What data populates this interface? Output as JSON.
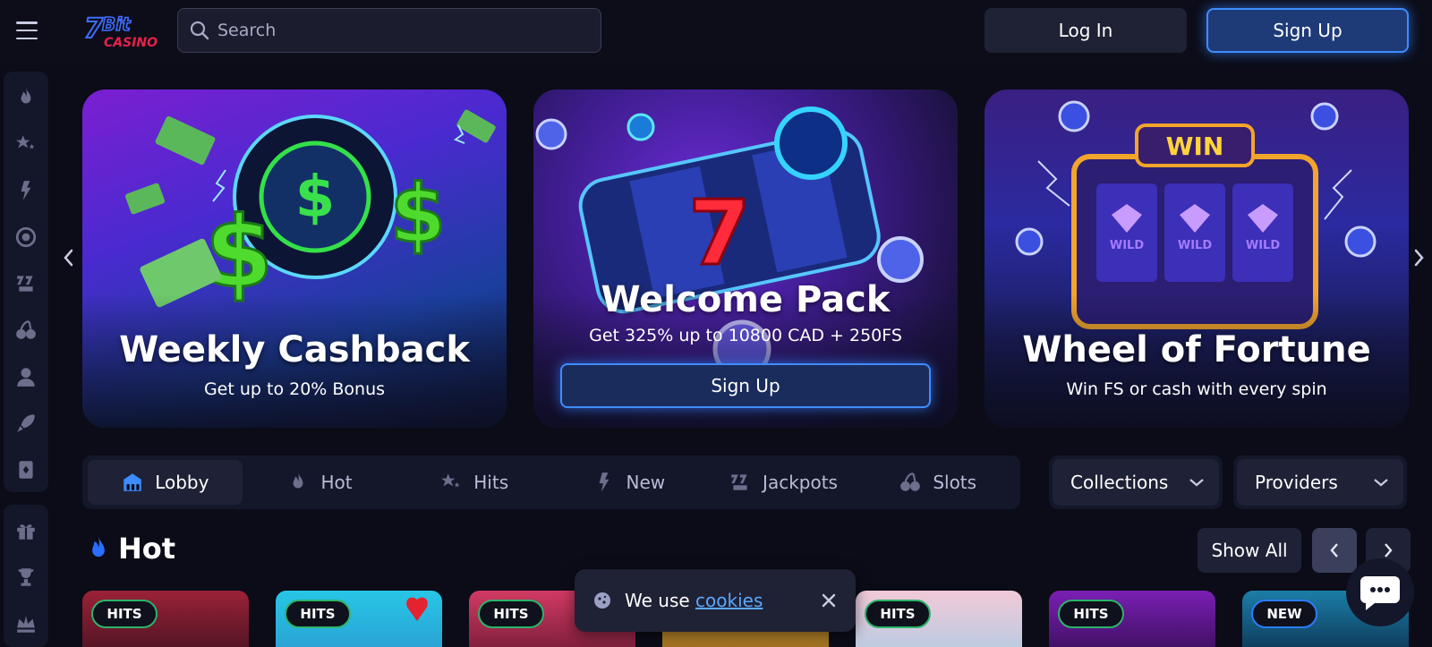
{
  "header": {
    "logo_text": "7Bit CASINO",
    "search_placeholder": "Search",
    "login_label": "Log In",
    "signup_label": "Sign Up"
  },
  "sidebar": {
    "items": [
      "fire-icon",
      "star-icon",
      "lightning-icon",
      "target-icon",
      "jackpot-icon",
      "cherry-icon",
      "live-dealer-icon",
      "rocket-icon",
      "card-icon"
    ],
    "secondary_items": [
      "gift-icon",
      "trophy-icon",
      "vip-icon"
    ]
  },
  "banners": [
    {
      "title": "Weekly Cashback",
      "subtitle": "Get up to 20% Bonus"
    },
    {
      "title": "Welcome Pack",
      "subtitle": "Get 325% up to 10800 CAD + 250FS",
      "cta": "Sign Up"
    },
    {
      "title": "Wheel of Fortune",
      "subtitle": "Win FS or cash with every spin",
      "art_text": "WIN",
      "reel_text": "WILD"
    }
  ],
  "tabs": [
    {
      "label": "Lobby",
      "active": true
    },
    {
      "label": "Hot"
    },
    {
      "label": "Hits"
    },
    {
      "label": "New"
    },
    {
      "label": "Jackpots"
    },
    {
      "label": "Slots"
    }
  ],
  "dropdowns": {
    "collections": "Collections",
    "providers": "Providers"
  },
  "section": {
    "title": "Hot",
    "show_all": "Show All"
  },
  "games": [
    {
      "badge": "HITS"
    },
    {
      "badge": "HITS"
    },
    {
      "badge": "HITS"
    },
    {
      "badge": ""
    },
    {
      "badge": "HITS"
    },
    {
      "badge": "HITS"
    },
    {
      "badge": "NEW"
    }
  ],
  "cookie": {
    "text": "We use",
    "link": "cookies"
  },
  "colors": {
    "accent": "#3f8cff",
    "background": "#0b0c17",
    "panel": "#14162a",
    "hits_border": "#2db36a"
  }
}
